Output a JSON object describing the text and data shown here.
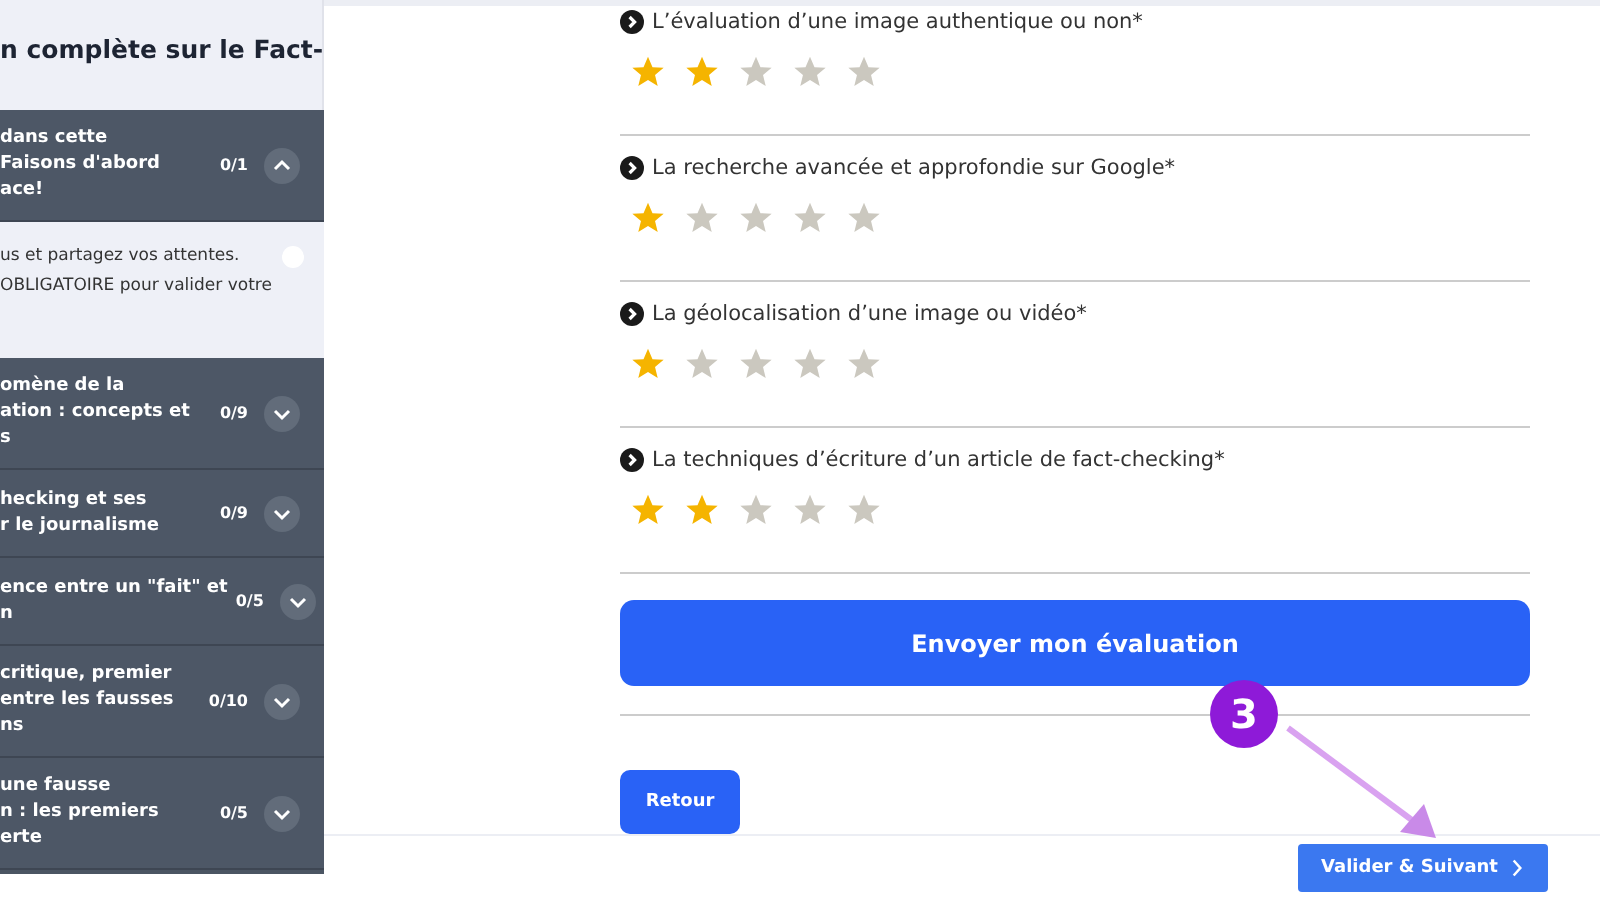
{
  "sidebar": {
    "header": "n complète sur le Fact-",
    "modules": [
      {
        "lines": [
          "dans cette",
          "Faisons d'abord",
          "ace!"
        ],
        "count": "0/1",
        "expanded": true,
        "lessons": [
          {
            "lines": [
              "us et partagez vos attentes.",
              "OBLIGATOIRE pour valider votre"
            ],
            "checked": false
          }
        ]
      },
      {
        "lines": [
          "omène de la",
          "ation : concepts et",
          "s"
        ],
        "count": "0/9",
        "expanded": false
      },
      {
        "lines": [
          "hecking et ses",
          "r le journalisme"
        ],
        "count": "0/9",
        "expanded": false
      },
      {
        "lines": [
          "ence entre un \"fait\" et",
          "n"
        ],
        "count": "0/5",
        "expanded": false
      },
      {
        "lines": [
          "critique, premier",
          "entre les fausses",
          "ns"
        ],
        "count": "0/10",
        "expanded": false
      },
      {
        "lines": [
          "une fausse",
          "n : les premiers",
          "erte"
        ],
        "count": "0/5",
        "expanded": false
      }
    ]
  },
  "ratings": [
    {
      "question": "L’évaluation d’une image authentique ou non*",
      "stars": 2
    },
    {
      "question": "La recherche avancée et approfondie sur Google*",
      "stars": 1
    },
    {
      "question": "La géolocalisation d’une image ou vidéo*",
      "stars": 1
    },
    {
      "question": "La techniques d’écriture d’un article de fact-checking*",
      "stars": 2
    }
  ],
  "submit_button": "Envoyer mon évaluation",
  "back_button": "Retour",
  "next_button": "Valider & Suivant",
  "step_badge": "3"
}
